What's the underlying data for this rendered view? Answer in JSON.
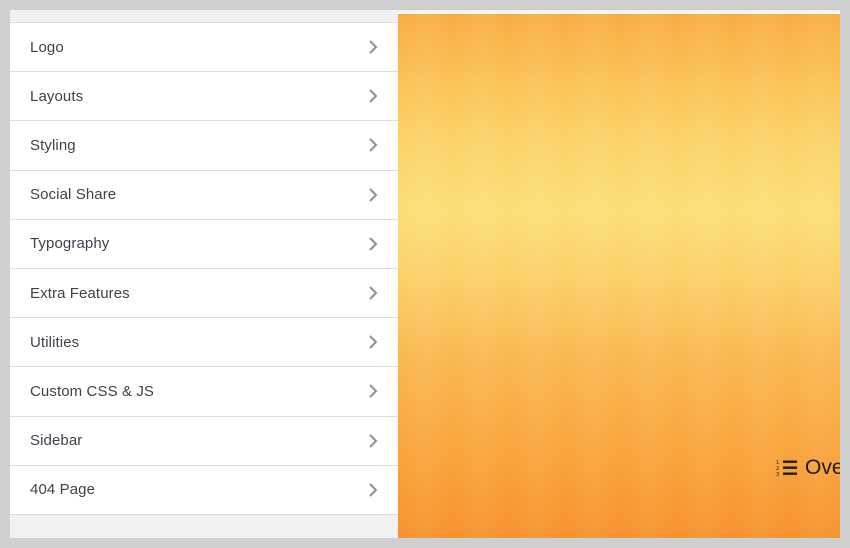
{
  "sidebar": {
    "items": [
      {
        "label": "Logo"
      },
      {
        "label": "Layouts"
      },
      {
        "label": "Styling"
      },
      {
        "label": "Social Share"
      },
      {
        "label": "Typography"
      },
      {
        "label": "Extra Features"
      },
      {
        "label": "Utilities"
      },
      {
        "label": "Custom CSS & JS"
      },
      {
        "label": "Sidebar"
      },
      {
        "label": "404 Page"
      }
    ]
  },
  "preview": {
    "overview_label": "Ove",
    "overview_icon": "ordered-list-icon",
    "gradient_colors": [
      "#f9ac45",
      "#fcde75",
      "#f7922e"
    ]
  },
  "colors": {
    "menu_text": "#3c434a",
    "chevron": "#8c8f94",
    "divider": "#dddddd",
    "background": "#f1f1f1"
  }
}
